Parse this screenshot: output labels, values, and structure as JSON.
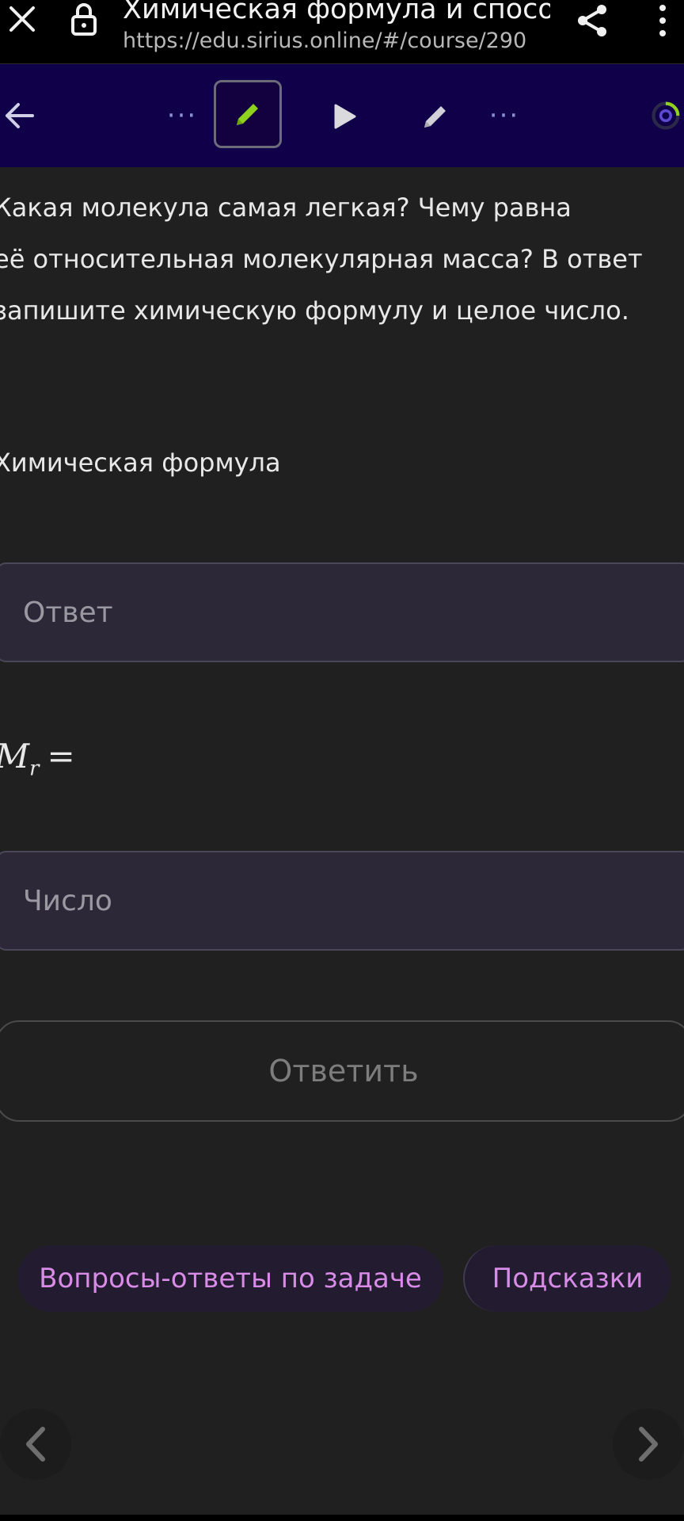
{
  "browser": {
    "title": "Химическая формула и способ...",
    "url": "https://edu.sirius.online/#/course/290"
  },
  "icons": {
    "close": "close-icon",
    "lock": "lock-icon",
    "share": "share-icon",
    "menu": "more-vert-icon",
    "back": "arrow-left-icon",
    "pencil": "pencil-icon",
    "play": "play-icon",
    "progress": "progress-ring-icon",
    "prev": "chevron-left-icon",
    "next": "chevron-right-icon"
  },
  "toolbar": {
    "dots_left": "···",
    "dots_right": "···"
  },
  "task": {
    "question_line1": "Какая молекула самая легкая? Чему равна",
    "question_line2": "её относительная молекулярная масса? В ответ",
    "question_line3": "запишите химическую формулу и целое число.",
    "formula_label": "Химическая формула",
    "answer_placeholder": "Ответ",
    "mass_symbol": "M",
    "mass_subscript": "r",
    "mass_equals": "=",
    "number_placeholder": "Число",
    "submit_label": "Ответить"
  },
  "footer": {
    "qa_label": "Вопросы-ответы по задаче",
    "hints_label": "Подсказки"
  },
  "colors": {
    "toolbar_bg": "#10004a",
    "accent_green": "#8fd11f",
    "pill_text": "#d98be8"
  }
}
